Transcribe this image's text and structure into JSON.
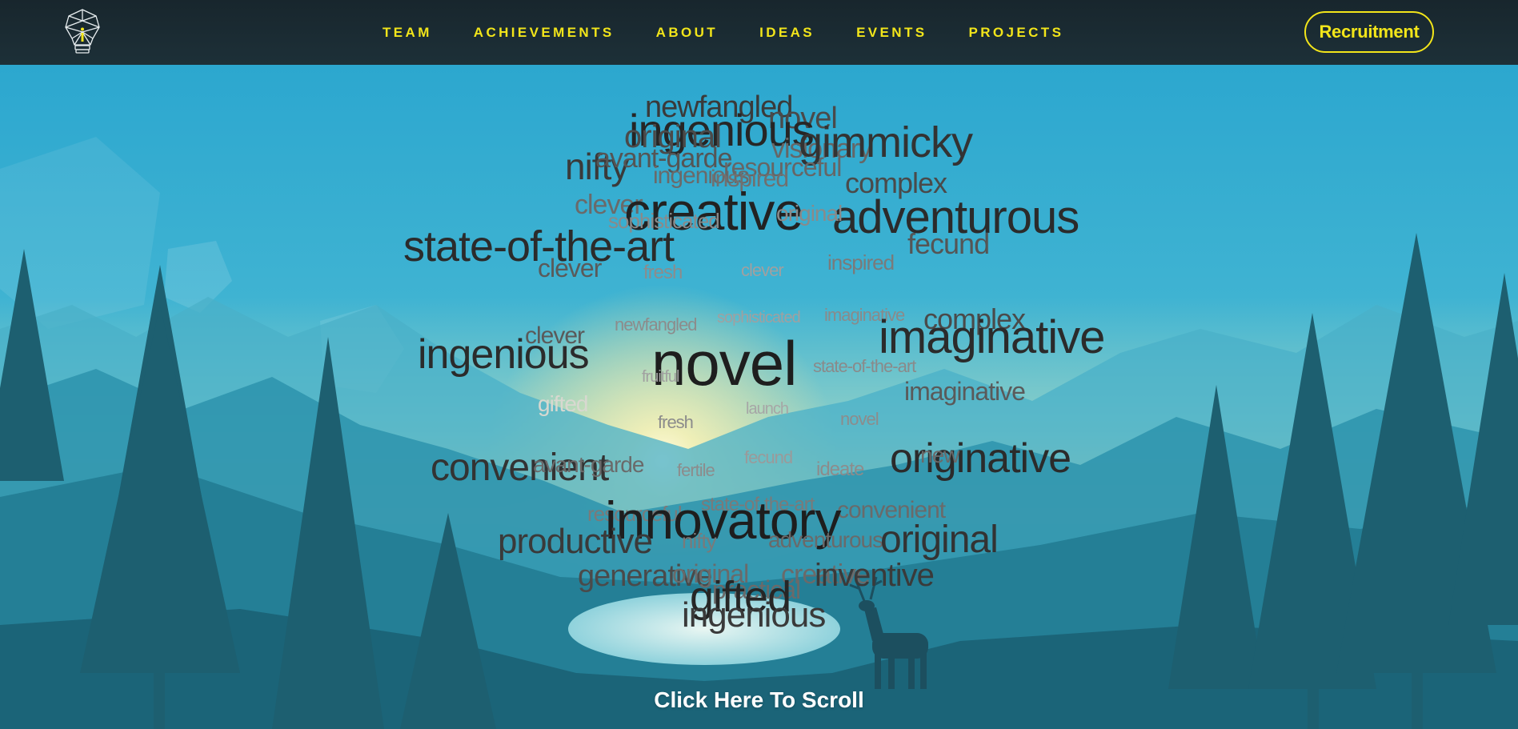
{
  "nav": {
    "logo_icon": "lightbulb-logo-icon",
    "links": [
      "TEAM",
      "ACHIEVEMENTS",
      "ABOUT",
      "IDEAS",
      "EVENTS",
      "PROJECTS"
    ],
    "cta": "Recruitment"
  },
  "colors": {
    "nav_background": "#1b2c34",
    "accent": "#f2e51a",
    "sky_top": "#2ca7cf",
    "horizon_glow": "#f4e6a0",
    "trees": "#1d5f70"
  },
  "word_cloud": {
    "words": [
      "newfangled",
      "novel",
      "ingenious",
      "original",
      "visionary",
      "gimmicky",
      "nifty",
      "avant-garde",
      "ingenious",
      "resourceful",
      "inspired",
      "complex",
      "clever",
      "creative",
      "adventurous",
      "sophisticated",
      "original",
      "state-of-the-art",
      "fecund",
      "clever",
      "fresh",
      "clever",
      "inspired",
      "newfangled",
      "sophisticated",
      "imaginative",
      "complex",
      "clever",
      "imaginative",
      "ingenious",
      "novel",
      "fruitful",
      "state-of-the-art",
      "imaginative",
      "gifted",
      "launch",
      "fresh",
      "novel",
      "originative",
      "fecund",
      "convenient",
      "avant-garde",
      "fertile",
      "ideate",
      "new",
      "resourceful",
      "state-of-the-art",
      "convenient",
      "innovatory",
      "productive",
      "nifty",
      "adventurous",
      "original",
      "generative",
      "original",
      "creative",
      "inventive",
      "practical",
      "gifted",
      "ingenious"
    ]
  },
  "scroll_cta": "Click Here To Scroll"
}
